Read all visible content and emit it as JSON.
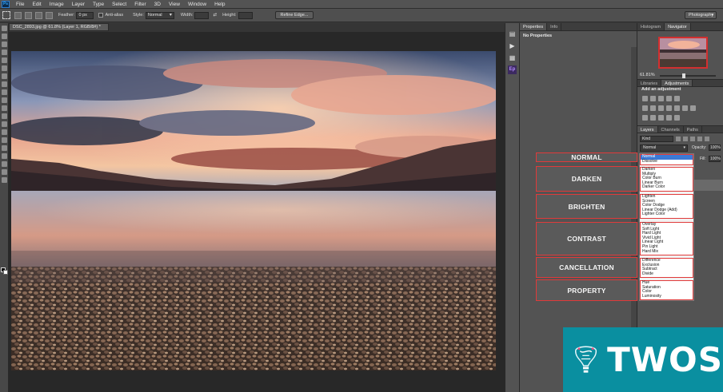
{
  "app": {
    "logo_text": "Ps",
    "menu": [
      "File",
      "Edit",
      "Image",
      "Layer",
      "Type",
      "Select",
      "Filter",
      "3D",
      "View",
      "Window",
      "Help"
    ]
  },
  "options_bar": {
    "feather_label": "Feather:",
    "feather_value": "0 px",
    "antialias_label": "Anti-alias",
    "style_label": "Style:",
    "style_value": "Normal",
    "width_label": "Width:",
    "height_label": "Height:",
    "refine_edge_label": "Refine Edge...",
    "workspace_label": "Photography"
  },
  "document": {
    "tab_title": "DSC_2893.jpg @ 61.8% (Layer 1, RGB/8#) *"
  },
  "properties_panel": {
    "tabs": [
      "Properties",
      "Info"
    ],
    "body_title": "No Properties"
  },
  "navigator_panel": {
    "tabs": [
      "Histogram",
      "Navigator"
    ],
    "zoom": "61.81%"
  },
  "adjustments_panel": {
    "tabs": [
      "Libraries",
      "Adjustments"
    ],
    "title": "Add an adjustment"
  },
  "layers_panel": {
    "tabs": [
      "Layers",
      "Channels",
      "Paths"
    ],
    "kind_filter": "Kind",
    "blend_mode": "Normal",
    "opacity_label": "Opacity:",
    "opacity_value": "100%",
    "fill_label": "Fill:",
    "fill_value": "100%"
  },
  "blend_modes": {
    "groups": [
      {
        "options": [
          "Normal",
          "Dissolve"
        ]
      },
      {
        "options": [
          "Darken",
          "Multiply",
          "Color Burn",
          "Linear Burn",
          "Darker Color"
        ]
      },
      {
        "options": [
          "Lighten",
          "Screen",
          "Color Dodge",
          "Linear Dodge (Add)",
          "Lighter Color"
        ]
      },
      {
        "options": [
          "Overlay",
          "Soft Light",
          "Hard Light",
          "Vivid Light",
          "Linear Light",
          "Pin Light",
          "Hard Mix"
        ]
      },
      {
        "options": [
          "Difference",
          "Exclusion",
          "Subtract",
          "Divide"
        ]
      },
      {
        "options": [
          "Hue",
          "Saturation",
          "Color",
          "Luminosity"
        ]
      }
    ],
    "selected": "Normal"
  },
  "categories": {
    "normal": "NORMAL",
    "darken": "DARKEN",
    "brighten": "BRIGHTEN",
    "contrast": "CONTRAST",
    "cancellation": "CANCELLATION",
    "property": "PROPERTY"
  },
  "watermark": {
    "brand": "TWOS"
  },
  "colors": {
    "accent": "#e03a3a",
    "selected_option": "#3c79d6",
    "watermark_bg": "#0a8fa0"
  }
}
